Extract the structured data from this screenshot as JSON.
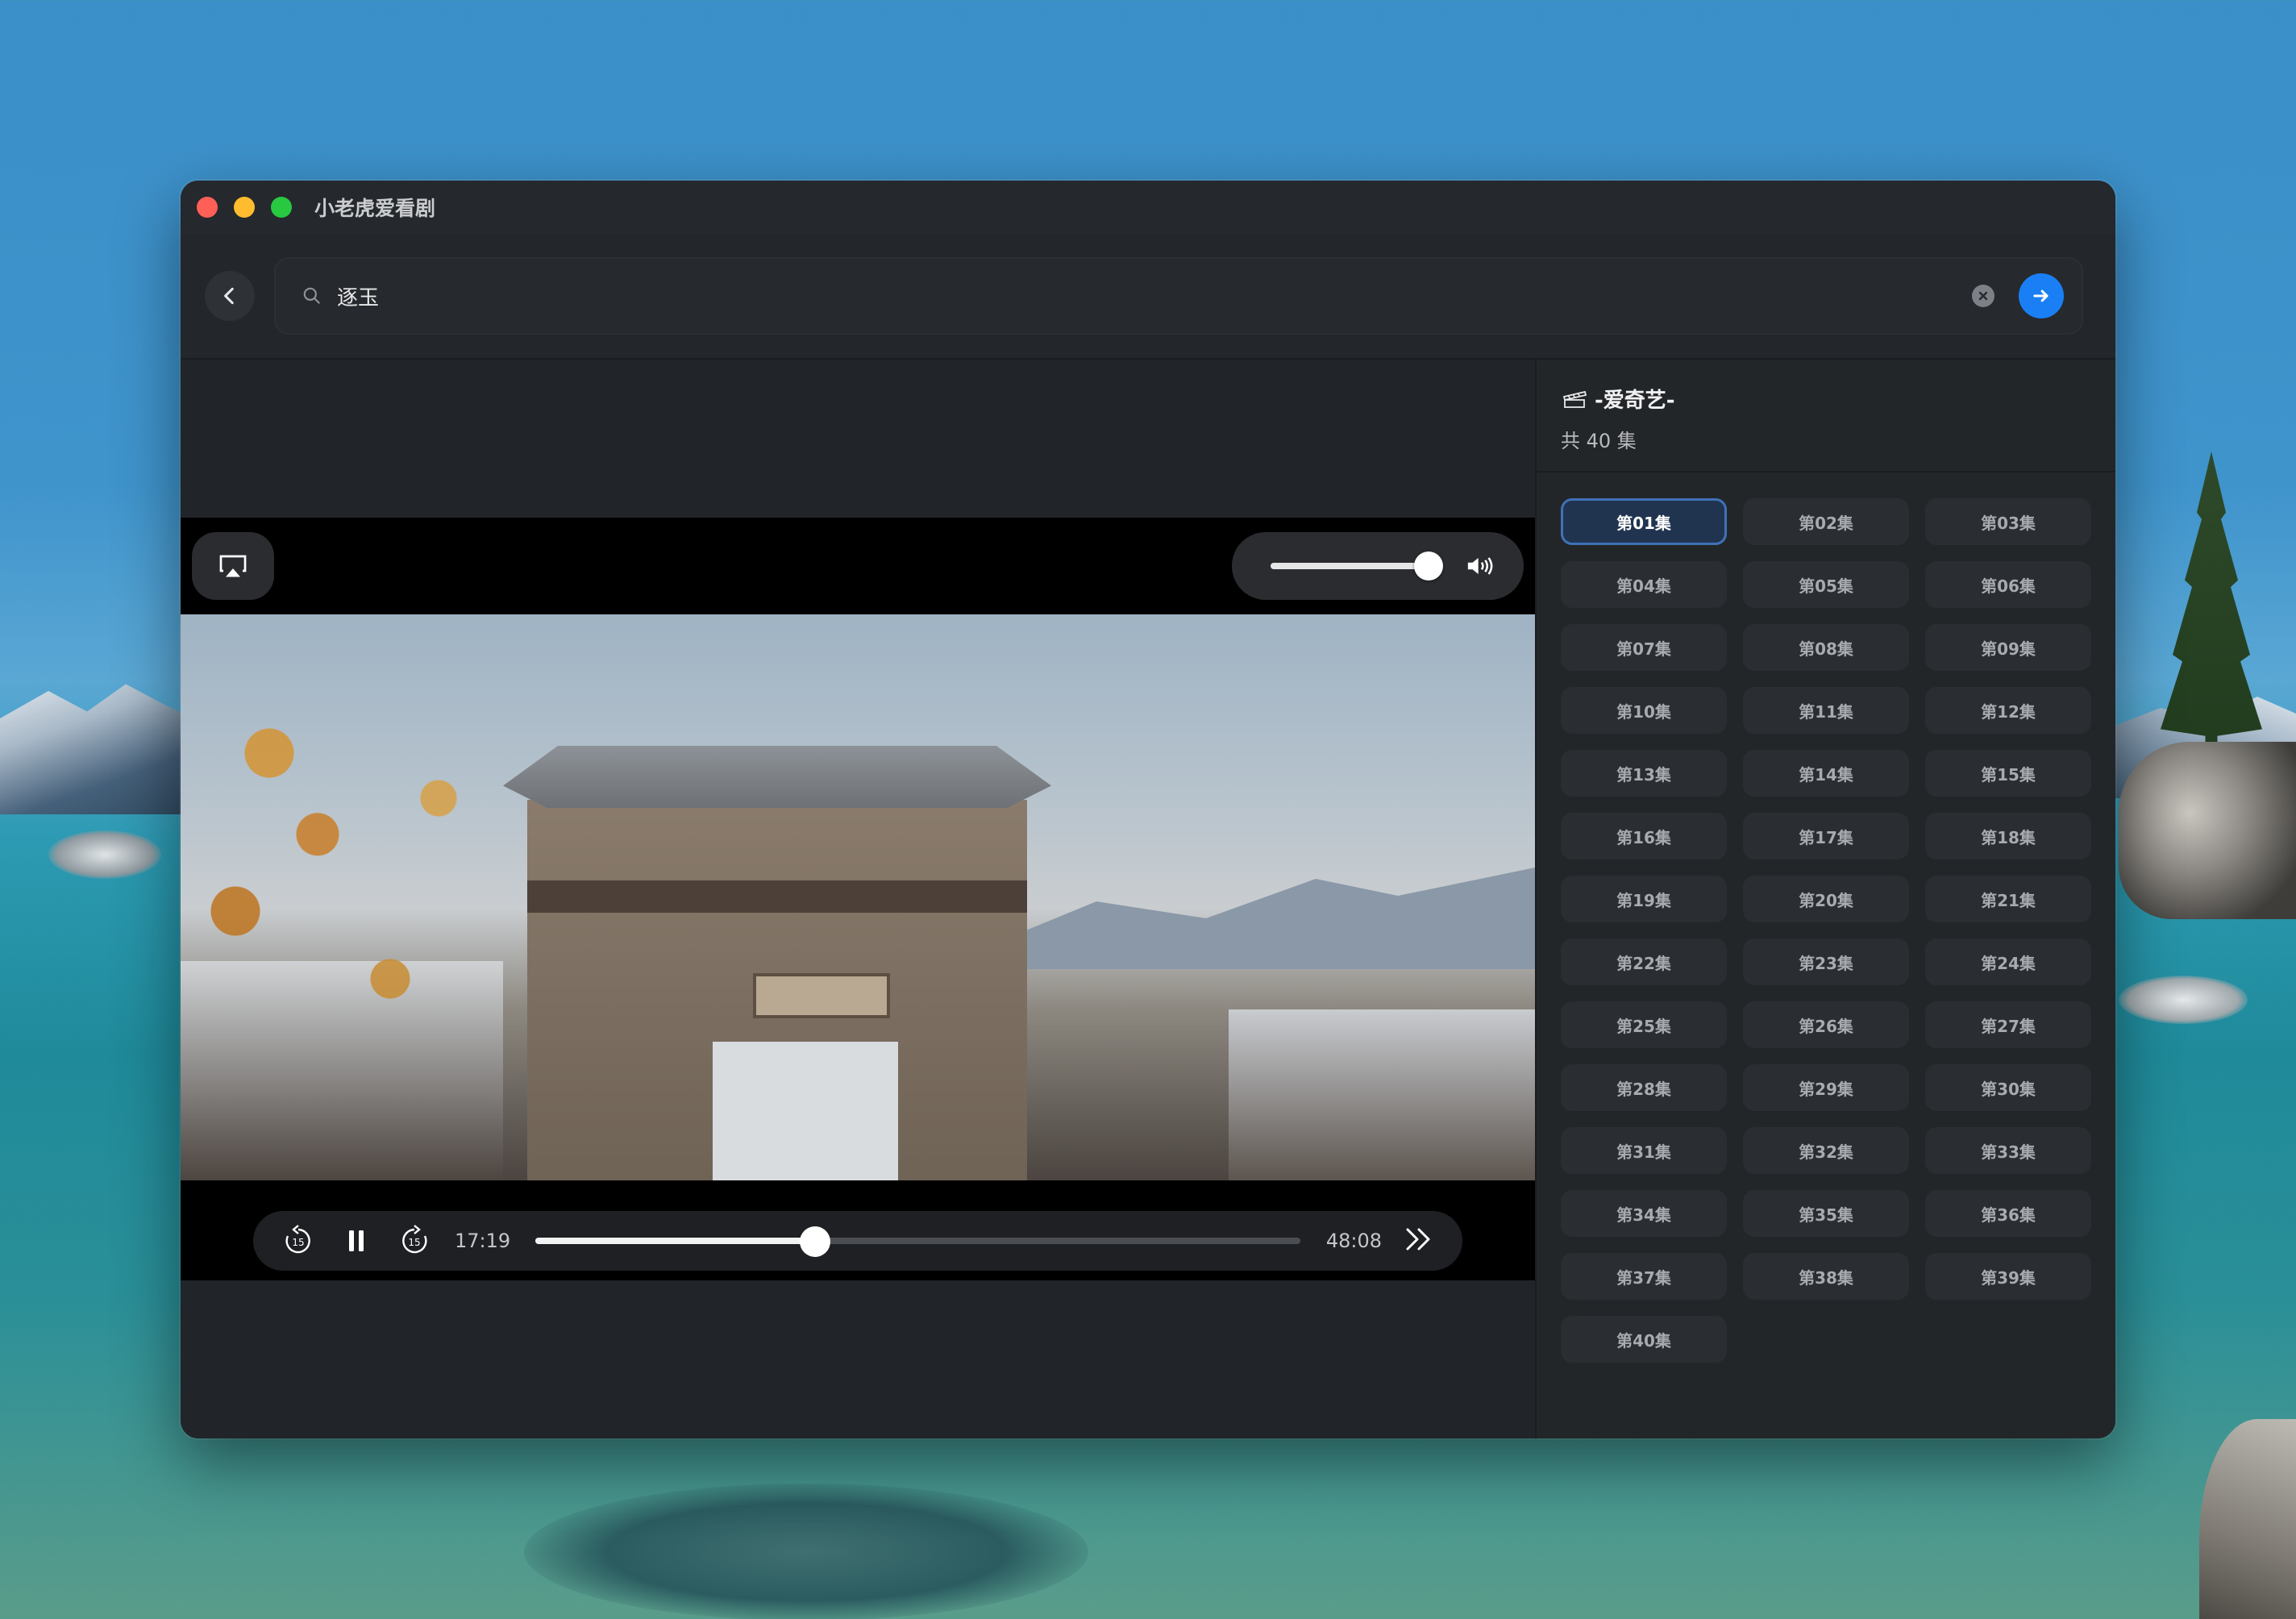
{
  "window": {
    "title": "小老虎爱看剧"
  },
  "search": {
    "query": "逐玉"
  },
  "player": {
    "current_time": "17:19",
    "total_time": "48:08",
    "progress": 0.366,
    "volume": 1.0,
    "skip_back_seconds": "15",
    "skip_forward_seconds": "15"
  },
  "source": {
    "name": "-爱奇艺-",
    "episode_count": "共 40 集"
  },
  "episodes": [
    "第01集",
    "第02集",
    "第03集",
    "第04集",
    "第05集",
    "第06集",
    "第07集",
    "第08集",
    "第09集",
    "第10集",
    "第11集",
    "第12集",
    "第13集",
    "第14集",
    "第15集",
    "第16集",
    "第17集",
    "第18集",
    "第19集",
    "第20集",
    "第21集",
    "第22集",
    "第23集",
    "第24集",
    "第25集",
    "第26集",
    "第27集",
    "第28集",
    "第29集",
    "第30集",
    "第31集",
    "第32集",
    "第33集",
    "第34集",
    "第35集",
    "第36集",
    "第37集",
    "第38集",
    "第39集",
    "第40集"
  ],
  "active_episode_index": 0,
  "colors": {
    "accent": "#1a7ff5",
    "active_episode_border": "#3f72b8"
  }
}
